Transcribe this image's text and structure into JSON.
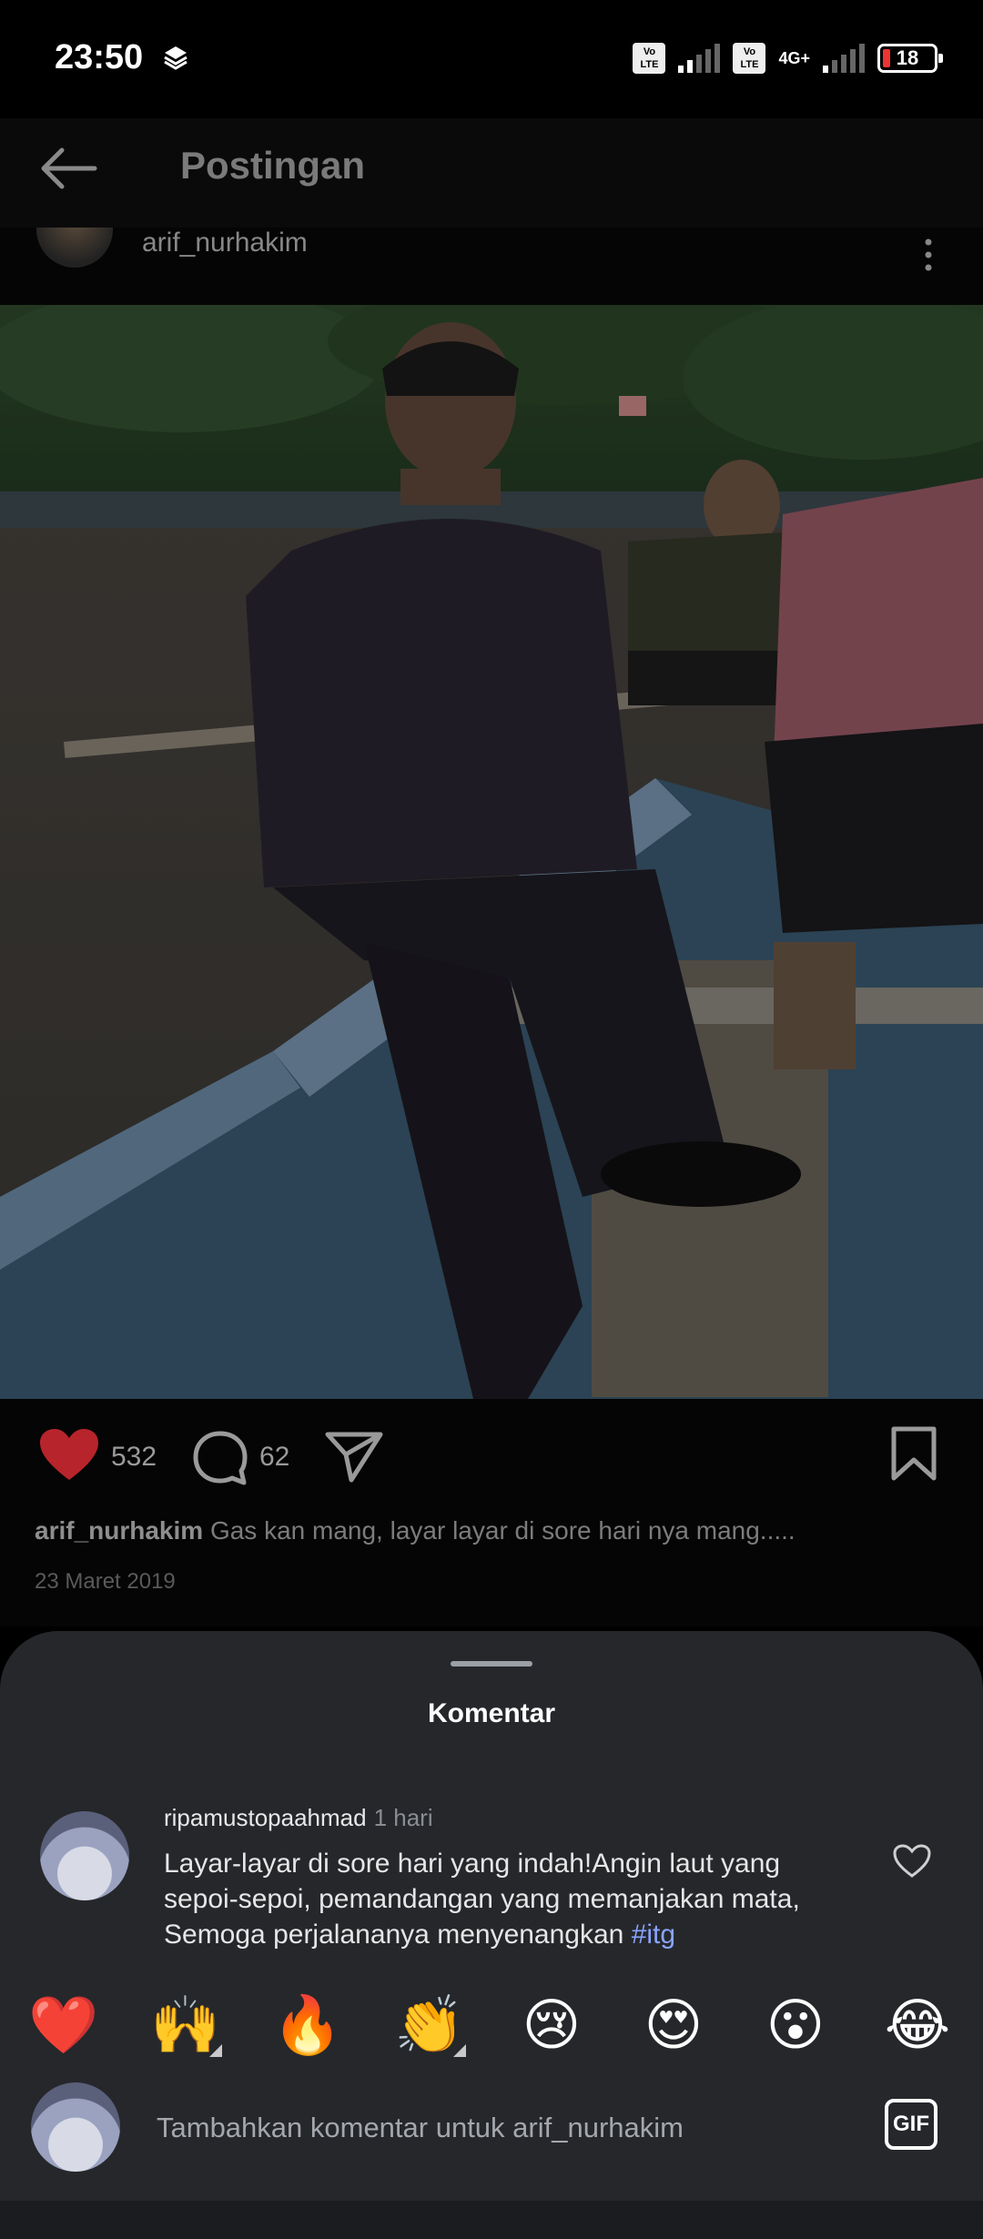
{
  "status_bar": {
    "time": "23:50",
    "volte_label": "Vo LTE",
    "network": "4G+",
    "battery": "18"
  },
  "header": {
    "title": "Postingan"
  },
  "post": {
    "username": "arif_nurhakim",
    "likes": "532",
    "comments": "62",
    "caption_user": "arif_nurhakim",
    "caption_text": "Gas kan mang, layar layar di sore hari nya mang.....",
    "date": "23 Maret 2019"
  },
  "comments_sheet": {
    "title": "Komentar",
    "comment": {
      "user": "ripamustopaahmad",
      "time": "1 hari",
      "text": "Layar-layar di sore hari yang indah!Angin laut yang sepoi-sepoi, pemandangan yang memanjakan mata, Semoga perjalananya menyenangkan",
      "hashtag": "#itg"
    },
    "emojis": [
      "❤️",
      "🙌",
      "🔥",
      "👏",
      "😢",
      "😍",
      "😮",
      "😂"
    ],
    "input_placeholder": "Tambahkan komentar untuk arif_nurhakim",
    "gif_label": "GIF"
  },
  "colors": {
    "like_red": "#b8242b",
    "sheet_bg": "#25272b",
    "hashtag": "#8aa4ff"
  }
}
